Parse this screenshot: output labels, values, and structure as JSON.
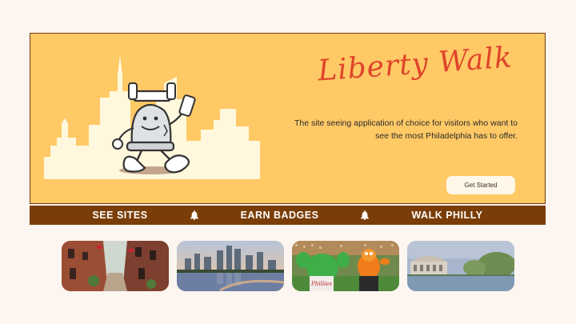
{
  "hero": {
    "brand": "Liberty Walk",
    "tagline": "The site seeing application of choice for visitors who want to see the most Philadelphia has to offer.",
    "cta_label": "Get Started"
  },
  "nav": {
    "items": [
      "SEE SITES",
      "EARN BADGES",
      "WALK PHILLY"
    ]
  },
  "thumbnails": [
    {
      "name": "elfreths-alley-photo"
    },
    {
      "name": "philadelphia-skyline-photo"
    },
    {
      "name": "mascots-photo"
    },
    {
      "name": "boathouse-row-photo"
    }
  ],
  "colors": {
    "background": "#fdf5ef",
    "hero": "#ffc966",
    "brand_red": "#e0442a",
    "nav_brown": "#7a3d07"
  }
}
